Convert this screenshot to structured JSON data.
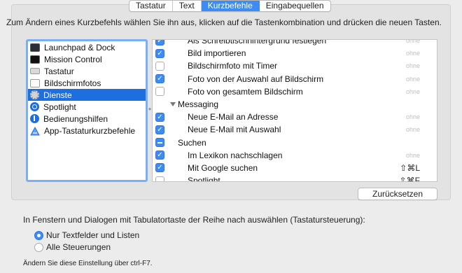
{
  "tabs": [
    {
      "label": "Tastatur",
      "selected": false
    },
    {
      "label": "Text",
      "selected": false
    },
    {
      "label": "Kurzbefehle",
      "selected": true
    },
    {
      "label": "Eingabequellen",
      "selected": false
    }
  ],
  "instruction": "Zum Ändern eines Kurzbefehls wählen Sie ihn aus, klicken auf die Tastenkombination und drücken die neuen Tasten.",
  "categories": [
    {
      "label": "Launchpad & Dock",
      "icon": "launchpad-icon",
      "selected": false
    },
    {
      "label": "Mission Control",
      "icon": "mission-control-icon",
      "selected": false
    },
    {
      "label": "Tastatur",
      "icon": "keyboard-icon",
      "selected": false
    },
    {
      "label": "Bildschirmfotos",
      "icon": "screenshot-icon",
      "selected": false
    },
    {
      "label": "Dienste",
      "icon": "services-gear-icon",
      "selected": true
    },
    {
      "label": "Spotlight",
      "icon": "spotlight-icon",
      "selected": false
    },
    {
      "label": "Bedienungshilfen",
      "icon": "accessibility-icon",
      "selected": false
    },
    {
      "label": "App-Tastaturkurzbefehle",
      "icon": "app-shortcuts-icon",
      "selected": false
    }
  ],
  "shortcuts": [
    {
      "label": "Als Schreibtischhintergrund festlegen",
      "check": "checked",
      "key": "ohne",
      "group": false
    },
    {
      "label": "Bild importieren",
      "check": "checked",
      "key": "ohne",
      "group": false
    },
    {
      "label": "Bildschirmfoto mit Timer",
      "check": "unchecked",
      "key": "ohne",
      "group": false
    },
    {
      "label": "Foto von der Auswahl auf Bildschirm",
      "check": "checked",
      "key": "ohne",
      "group": false
    },
    {
      "label": "Foto von gesamtem Bildschirm",
      "check": "unchecked",
      "key": "ohne",
      "group": false
    },
    {
      "label": "Messaging",
      "check": "none",
      "key": "",
      "group": true
    },
    {
      "label": "Neue E-Mail an Adresse",
      "check": "checked",
      "key": "ohne",
      "group": false
    },
    {
      "label": "Neue E-Mail mit Auswahl",
      "check": "checked",
      "key": "ohne",
      "group": false
    },
    {
      "label": "Suchen",
      "check": "mixed",
      "key": "",
      "group": true
    },
    {
      "label": "Im Lexikon nachschlagen",
      "check": "checked",
      "key": "ohne",
      "group": false
    },
    {
      "label": "Mit Google suchen",
      "check": "checked",
      "key": "⇧⌘L",
      "group": false
    },
    {
      "label": "Spotlight",
      "check": "unchecked",
      "key": "⇧⌘F",
      "group": false
    }
  ],
  "reset_label": "Zurücksetzen",
  "full_keyboard": {
    "description": "In Fenstern und Dialogen mit Tabulatortaste der Reihe nach auswählen (Tastatursteuerung):",
    "options": [
      {
        "label": "Nur Textfelder und Listen",
        "selected": true
      },
      {
        "label": "Alle Steuerungen",
        "selected": false
      }
    ],
    "hint": "Ändern Sie diese Einstellung über ctrl-F7."
  },
  "colors": {
    "accent": "#3c8cf5",
    "selection": "#1d6fe0",
    "focus_ring": "#7aaef5"
  }
}
